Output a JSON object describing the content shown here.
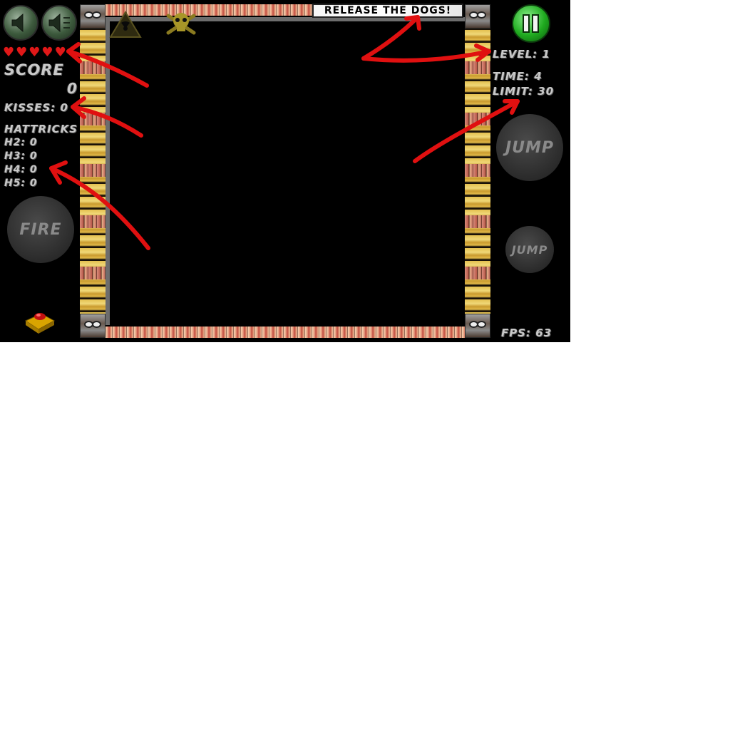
{
  "hud": {
    "lives": 5,
    "score_label": "SCORE",
    "score_value": "0",
    "kisses": "KISSES: 0",
    "hattricks_label": "HATTRICKS",
    "h2": "H2: 0",
    "h3": "H3: 0",
    "h4": "H4: 0",
    "h5": "H5: 0",
    "level": "LEVEL: 1",
    "time": "TIME: 4",
    "limit": "LIMIT: 30",
    "fps": "FPS: 63"
  },
  "banner": {
    "text": "RELEASE THE DOGS!"
  },
  "controls": {
    "fire_label": "FIRE",
    "jump_big_label": "JUMP",
    "jump_small_label": "JUMP"
  },
  "icons": {
    "sound_effects": "speaker-icon",
    "music": "speaker-music-icon",
    "pause": "pause-icon",
    "hazard": "radiation-warning-icon",
    "skull": "skull-crossbones-icon",
    "panic_button": "red-button-icon"
  },
  "colors": {
    "background": "#000000",
    "hud_text": "#c9c9c9",
    "heart": "#e01818",
    "pause_green": "#1faa1f",
    "annotation_red": "#e01010"
  }
}
